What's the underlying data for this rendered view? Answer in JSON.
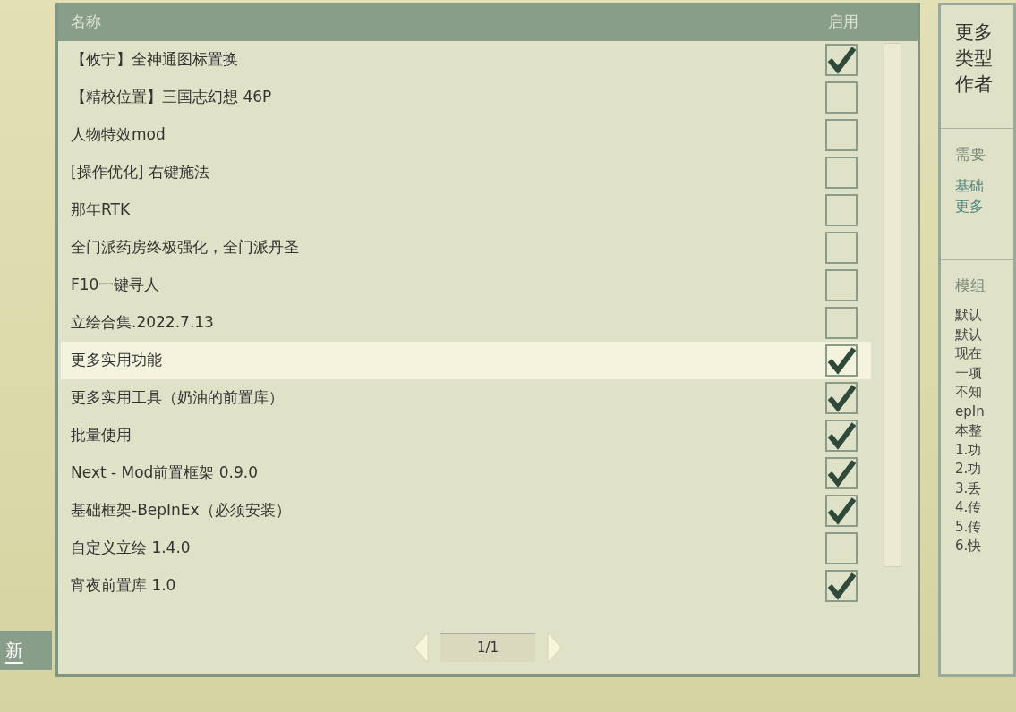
{
  "side_button": {
    "label": "新"
  },
  "mod_list": {
    "columns": [
      "名称",
      "启用"
    ],
    "rows": [
      {
        "name": "【攸宁】全神通图标置换",
        "enabled": true,
        "selected": false
      },
      {
        "name": "【精校位置】三国志幻想 46P",
        "enabled": false,
        "selected": false
      },
      {
        "name": "人物特效mod",
        "enabled": false,
        "selected": false
      },
      {
        "name": "[操作优化] 右键施法",
        "enabled": false,
        "selected": false
      },
      {
        "name": "那年RTK",
        "enabled": false,
        "selected": false
      },
      {
        "name": "全门派药房终极强化，全门派丹圣",
        "enabled": false,
        "selected": false
      },
      {
        "name": "F10一键寻人",
        "enabled": false,
        "selected": false
      },
      {
        "name": "立绘合集.2022.7.13",
        "enabled": false,
        "selected": false
      },
      {
        "name": "更多实用功能",
        "enabled": true,
        "selected": true
      },
      {
        "name": "更多实用工具（奶油的前置库）",
        "enabled": true,
        "selected": false
      },
      {
        "name": "批量使用",
        "enabled": true,
        "selected": false
      },
      {
        "name": "Next - Mod前置框架 0.9.0",
        "enabled": true,
        "selected": false
      },
      {
        "name": "基础框架-BepInEx（必须安装）",
        "enabled": true,
        "selected": false
      },
      {
        "name": "自定义立绘 1.4.0",
        "enabled": false,
        "selected": false
      },
      {
        "name": "宵夜前置库 1.0",
        "enabled": true,
        "selected": false
      }
    ],
    "pager": {
      "page": "1/1"
    }
  },
  "details": {
    "info_lines": [
      "更多",
      "类型",
      "作者"
    ],
    "requires_heading": "需要",
    "requires": [
      "基础",
      "更多"
    ],
    "description_heading": "模组",
    "description_lines": [
      "默认",
      "默认",
      "现在",
      "一项",
      "不知",
      "epIn",
      "本整",
      "1.功",
      "2.功",
      "3.丢",
      "4.传",
      "5.传",
      "6.快"
    ]
  }
}
